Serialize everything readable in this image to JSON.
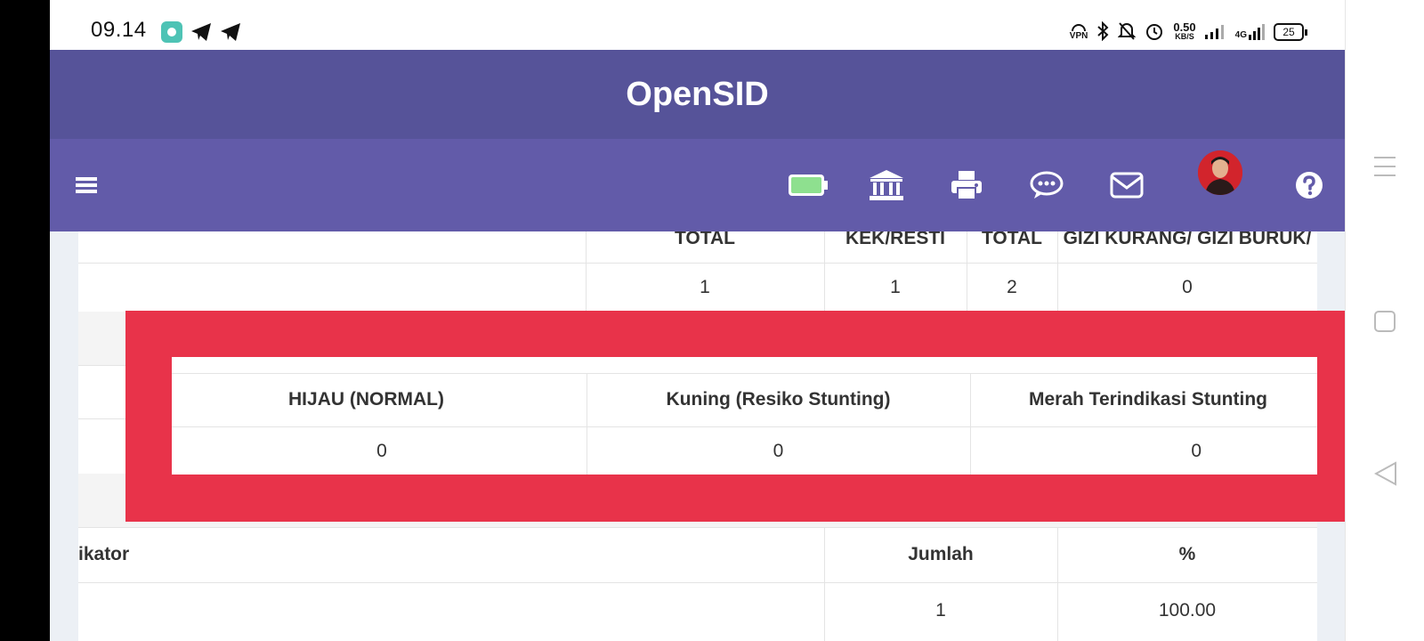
{
  "status": {
    "time": "09.14",
    "vpn": "VPN",
    "speed_value": "0.50",
    "speed_unit": "KB/S",
    "network": "4G",
    "battery": "25"
  },
  "app": {
    "title": "OpenSID"
  },
  "nav": {
    "icons": [
      "menu-icon",
      "battery-icon",
      "bank-icon",
      "printer-icon",
      "chat-icon",
      "mail-icon",
      "avatar",
      "help-icon"
    ]
  },
  "table_top": {
    "headers": [
      "TOTAL",
      "KEK/RESTI",
      "TOTAL",
      "GIZI KURANG/ GIZI BURUK/"
    ],
    "values": [
      "1",
      "1",
      "2",
      "0"
    ]
  },
  "highlight_table": {
    "headers": [
      "HIJAU (NORMAL)",
      "Kuning (Resiko Stunting)",
      "Merah Terindikasi Stunting"
    ],
    "values": [
      "0",
      "0",
      "0"
    ]
  },
  "table_bottom": {
    "headers": [
      "ikator",
      "Jumlah",
      "%"
    ],
    "values": [
      "1",
      "100.00"
    ]
  },
  "colors": {
    "title_bar": "#565399",
    "nav_bar": "#625ba9",
    "highlight": "#e8334a",
    "battery_green": "#8ee08f"
  }
}
